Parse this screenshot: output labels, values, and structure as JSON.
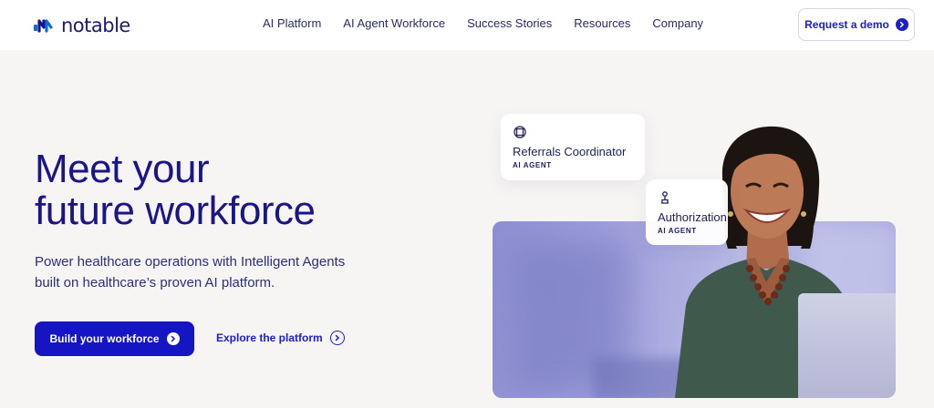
{
  "brand": {
    "name": "notable"
  },
  "nav": {
    "links": [
      "AI Platform",
      "AI Agent Workforce",
      "Success Stories",
      "Resources",
      "Company"
    ],
    "cta_label": "Request a demo"
  },
  "hero": {
    "headline_line1": "Meet your",
    "headline_line2": "future workforce",
    "subhead": "Power healthcare operations with Intelligent Agents built on healthcare’s proven AI platform.",
    "primary_cta": "Build your workforce",
    "secondary_cta": "Explore the platform"
  },
  "agent_cards": [
    {
      "title": "Referrals Coordinator",
      "tag": "AI AGENT",
      "icon": "referrals-icon"
    },
    {
      "title": "Authorization",
      "tag": "AI AGENT",
      "icon": "authorization-icon"
    }
  ],
  "colors": {
    "brand_navy": "#1a1688",
    "accent_blue": "#1615c4",
    "page_bg": "#f7f5f3",
    "photo_tint": "#a5a6de"
  }
}
